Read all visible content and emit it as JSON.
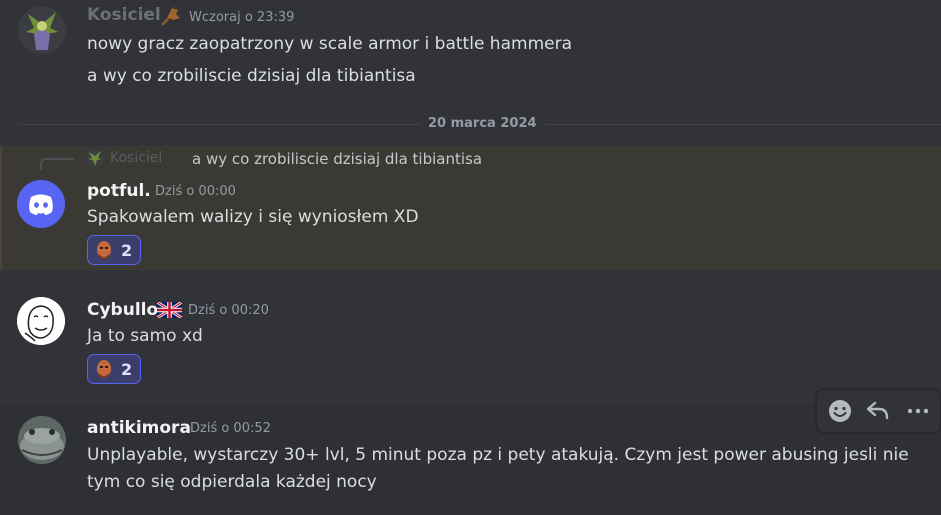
{
  "message1": {
    "username": "Kosiciel",
    "timestamp": "Wczoraj o 23:39",
    "lines": [
      "nowy gracz zaopatrzony w scale armor i battle hammera",
      "a wy co zrobiliscie dzisiaj dla tibiantisa"
    ]
  },
  "date_divider": "20 marca 2024",
  "message2": {
    "reply_username": "Kosiciel",
    "reply_text": "a wy co zrobiliscie dzisiaj dla tibiantisa",
    "username": "potful.",
    "timestamp": "Dziś o 00:00",
    "text": "Spakowalem walizy i się wyniosłem XD",
    "reaction_count": "2"
  },
  "message3": {
    "username": "Cybullo",
    "timestamp": "Dziś o 00:20",
    "text": "Ja to samo xd",
    "reaction_count": "2"
  },
  "message4": {
    "username": "antikimora",
    "timestamp": "Dziś o 00:52",
    "lines": [
      "Unplayable, wystarczy 30+ lvl, 5 minut poza pz i pety atakują. Czym jest power abusing jesli nie",
      "tym co się odpierdala każdej nocy"
    ]
  },
  "colors": {
    "background": "#313338",
    "highlight": "#3a3934",
    "hover": "#2e3035",
    "accent": "#5865f2"
  }
}
